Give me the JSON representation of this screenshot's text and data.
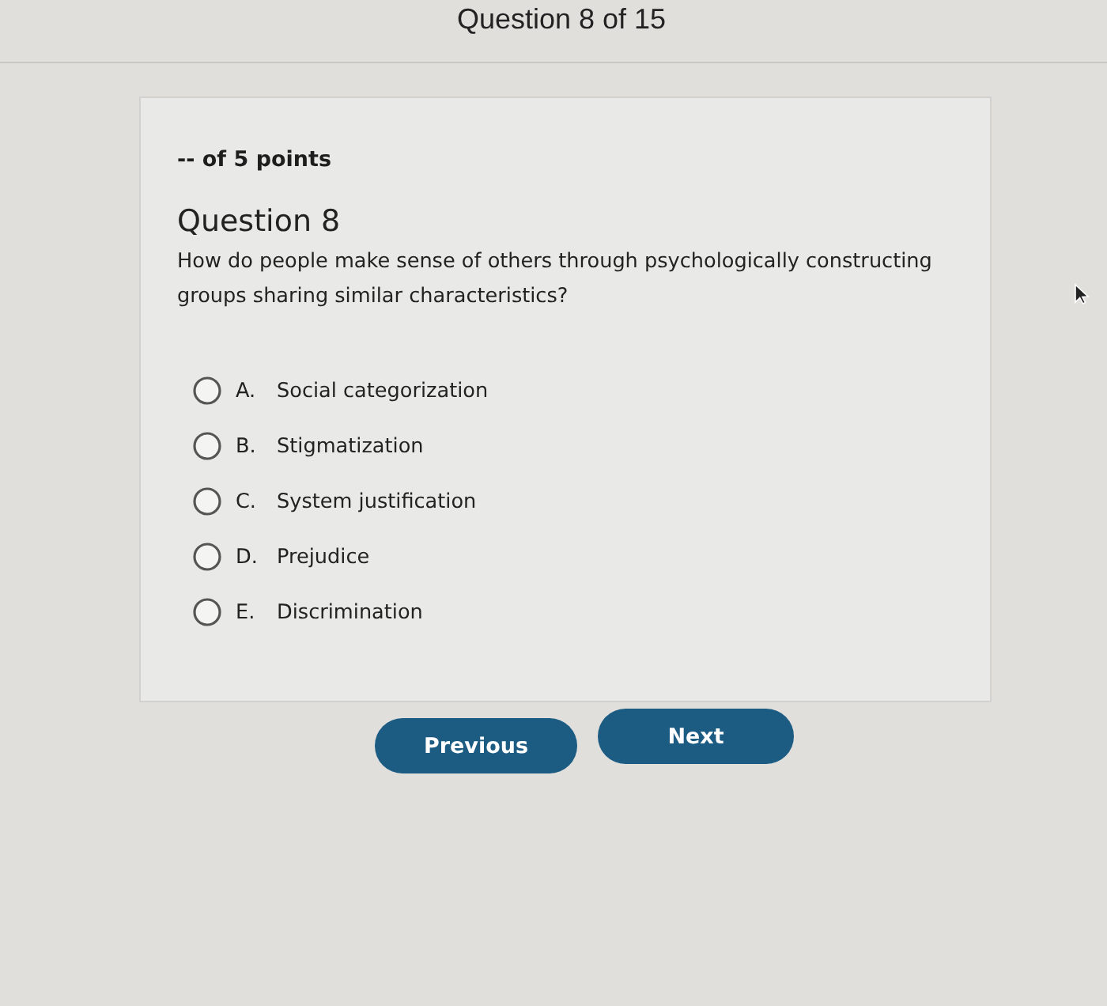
{
  "header": {
    "title": "Question 8 of 15"
  },
  "question": {
    "points": "-- of 5 points",
    "title": "Question 8",
    "text": "How do people make sense of others through psychologically constructing groups sharing similar characteristics?",
    "options": [
      {
        "letter": "A.",
        "label": "Social categorization",
        "selected": false
      },
      {
        "letter": "B.",
        "label": "Stigmatization",
        "selected": false
      },
      {
        "letter": "C.",
        "label": "System justification",
        "selected": false
      },
      {
        "letter": "D.",
        "label": "Prejudice",
        "selected": false
      },
      {
        "letter": "E.",
        "label": "Discrimination",
        "selected": false
      }
    ]
  },
  "buttons": [
    {
      "kind": "previous",
      "label": "Previous"
    },
    {
      "kind": "next",
      "label": "Next"
    }
  ]
}
